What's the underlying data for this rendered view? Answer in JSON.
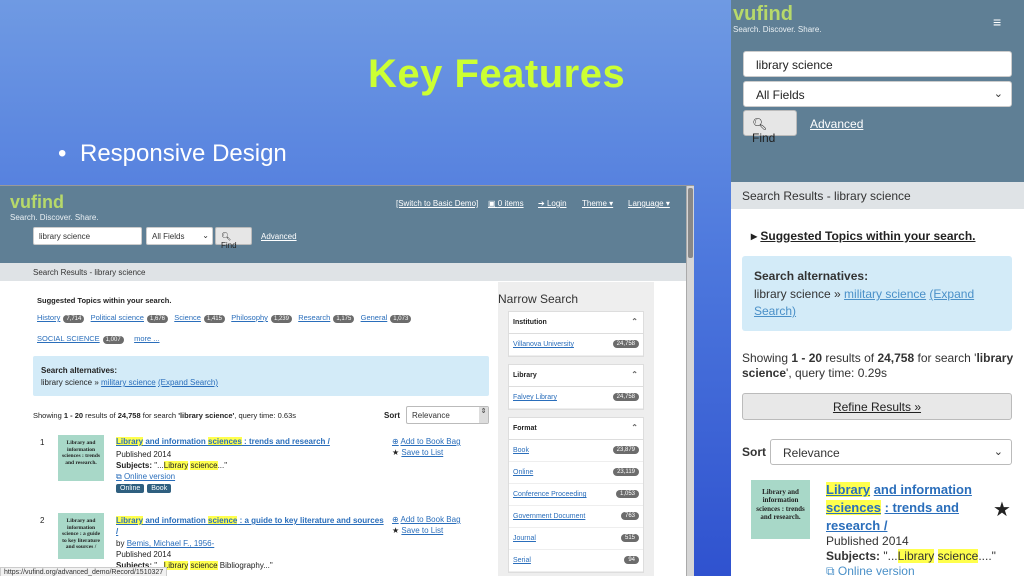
{
  "slide": {
    "title": "Key Features",
    "bullet_symbol": "•",
    "bullet": "Responsive Design"
  },
  "desktop": {
    "logo": "vufind",
    "tagline": "Search. Discover. Share.",
    "nav": {
      "basic_demo": "[Switch to Basic Demo]",
      "items": "0 items",
      "login": "Login",
      "theme": "Theme ▾",
      "language": "Language ▾"
    },
    "search": {
      "query": "library science",
      "field": "All Fields",
      "find": "Find",
      "advanced": "Advanced"
    },
    "breadcrumb": "Search Results - library science",
    "suggested_heading": "Suggested Topics within your search.",
    "topics": [
      {
        "label": "History",
        "count": "7,714"
      },
      {
        "label": "Political science",
        "count": "1,676"
      },
      {
        "label": "Science",
        "count": "1,415"
      },
      {
        "label": "Philosophy",
        "count": "1,239"
      },
      {
        "label": "Research",
        "count": "1,175"
      },
      {
        "label": "General",
        "count": "1,073"
      }
    ],
    "topic_social": {
      "label": "SOCIAL SCIENCE",
      "count": "1,007"
    },
    "more": "more ...",
    "alternatives": {
      "heading": "Search alternatives",
      "line_prefix": "library science »",
      "military": "military science",
      "expand": "(Expand Search)"
    },
    "showing": {
      "pre": "Showing",
      "range": "1 - 20",
      "mid": "results of",
      "total": "24,758",
      "mid2": "for search",
      "query": "'library science'",
      "time": ", query time: 0.63s"
    },
    "sort": {
      "label": "Sort",
      "value": "Relevance"
    },
    "results": [
      {
        "num": "1",
        "thumb": "Library and information sciences : trends and research.",
        "t_hl1": "Library",
        "t_mid": " and information ",
        "t_hl2": "sciences",
        "t_tail": " : trends and research /",
        "published": "Published 2014",
        "subjects_label": "Subjects:",
        "subjects_pre": "\"...",
        "subj_hl1": "Library",
        "subj_hl2": "science",
        "subjects_post": "...\"",
        "online": "Online version",
        "formats": [
          "Online",
          "Book"
        ],
        "bag": "Add to Book Bag",
        "list": "Save to List"
      },
      {
        "num": "2",
        "thumb": "Library and information science : a guide to key literature and sources /",
        "t_hl1": "Library",
        "t_mid": " and information ",
        "t_hl2": "science",
        "t_tail": " : a guide to key literature and sources /",
        "by": "by",
        "author": "Bemis, Michael F., 1956-",
        "published": "Published 2014",
        "subjects_label": "Subjects:",
        "subjects_pre": "\"...",
        "subj_hl1": "Library",
        "subj_hl2": "science",
        "subjects_post": " Bibliography...\"",
        "bag": "Add to Book Bag",
        "list": "Save to List"
      }
    ],
    "narrow": "Narrow Search",
    "facets": [
      {
        "heading": "Institution",
        "items": [
          {
            "label": "Villanova University",
            "count": "24,758"
          }
        ]
      },
      {
        "heading": "Library",
        "items": [
          {
            "label": "Falvey Library",
            "count": "24,758"
          }
        ]
      },
      {
        "heading": "Format",
        "items": [
          {
            "label": "Book",
            "count": "23,879"
          },
          {
            "label": "Online",
            "count": "23,119"
          },
          {
            "label": "Conference Proceeding",
            "count": "1,053"
          },
          {
            "label": "Government Document",
            "count": "763"
          },
          {
            "label": "Journal",
            "count": "515"
          },
          {
            "label": "Serial",
            "count": "94"
          }
        ]
      }
    ],
    "status_url": "https://vufind.org/advanced_demo/Record/1510327"
  },
  "mobile": {
    "logo": "vufind",
    "tagline": "Search. Discover. Share.",
    "menu_icon": "≡",
    "search": {
      "query": "library science",
      "field": "All Fields",
      "find": "Find",
      "advanced": "Advanced"
    },
    "breadcrumb": "Search Results - library science",
    "suggested": "Suggested Topics within your search.",
    "alternatives": {
      "heading": "Search alternatives",
      "line_prefix": "library science »",
      "military": "military science",
      "expand": "(Expand",
      "expand2": "Search)"
    },
    "showing": {
      "pre": "Showing",
      "range": "1 - 20",
      "mid": "results of",
      "total": "24,758",
      "mid2": "for search '",
      "q1": "library",
      "q2": "science",
      "time": "', query time: 0.29s"
    },
    "refine": "Refine Results »",
    "sort": {
      "label": "Sort",
      "value": "Relevance"
    },
    "result": {
      "thumb": "Library and information sciences : trends and research.",
      "t1": "Library",
      "t2": "and information",
      "t3": "sciences",
      "t4": ": trends and",
      "t5": "research /",
      "published": "Published 2014",
      "subjects_label": "Subjects:",
      "subjects_pre": "\"...",
      "subj_hl1": "Library",
      "subj_hl2": "science",
      "subjects_post": "....\"",
      "online": "Online version"
    }
  },
  "colors": {
    "title": "#ccff33",
    "header": "#5f7f95",
    "link": "#2a6ebb",
    "highlight": "#ffff4d"
  }
}
